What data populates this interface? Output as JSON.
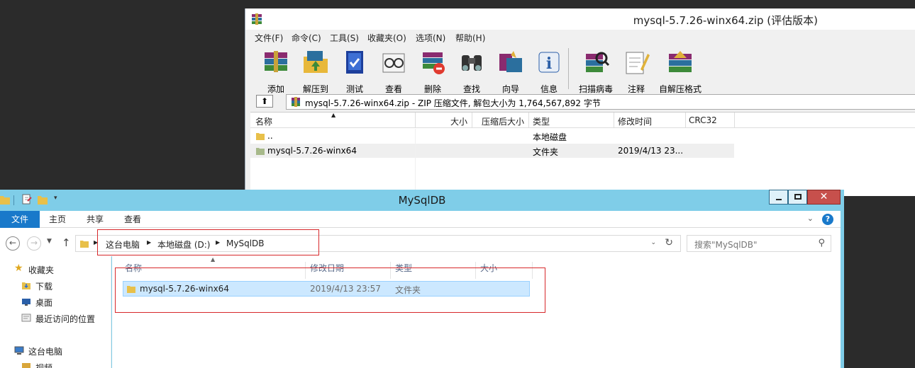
{
  "winrar": {
    "title": "mysql-5.7.26-winx64.zip (评估版本)",
    "menu": [
      "文件(F)",
      "命令(C)",
      "工具(S)",
      "收藏夹(O)",
      "选项(N)",
      "帮助(H)"
    ],
    "toolbar": [
      "添加",
      "解压到",
      "测试",
      "查看",
      "删除",
      "查找",
      "向导",
      "信息",
      "扫描病毒",
      "注释",
      "自解压格式"
    ],
    "address": "mysql-5.7.26-winx64.zip - ZIP 压缩文件, 解包大小为 1,764,567,892 字节",
    "columns": [
      "名称",
      "大小",
      "压缩后大小",
      "类型",
      "修改时间",
      "CRC32"
    ],
    "rows": [
      {
        "name": "..",
        "type": "本地磁盘",
        "modified": ""
      },
      {
        "name": "mysql-5.7.26-winx64",
        "type": "文件夹",
        "modified": "2019/4/13 23..."
      }
    ]
  },
  "explorer": {
    "title": "MySqlDB",
    "ribbon_tabs": [
      "文件",
      "主页",
      "共享",
      "查看"
    ],
    "breadcrumb": [
      "这台电脑",
      "本地磁盘 (D:)",
      "MySqlDB"
    ],
    "search_placeholder": "搜索\"MySqlDB\"",
    "nav": {
      "favorites": "收藏夹",
      "downloads": "下载",
      "desktop": "桌面",
      "recent": "最近访问的位置",
      "this_pc": "这台电脑",
      "videos": "视频"
    },
    "columns": [
      "名称",
      "修改日期",
      "类型",
      "大小"
    ],
    "files": [
      {
        "name": "mysql-5.7.26-winx64",
        "modified": "2019/4/13 23:57",
        "type": "文件夹",
        "size": ""
      }
    ]
  },
  "colors": {
    "explorer_frame": "#7fcde8",
    "file_tab": "#1979ca",
    "close_button": "#c7504c",
    "selection": "#cce8ff",
    "highlight_box": "#d7282b"
  }
}
